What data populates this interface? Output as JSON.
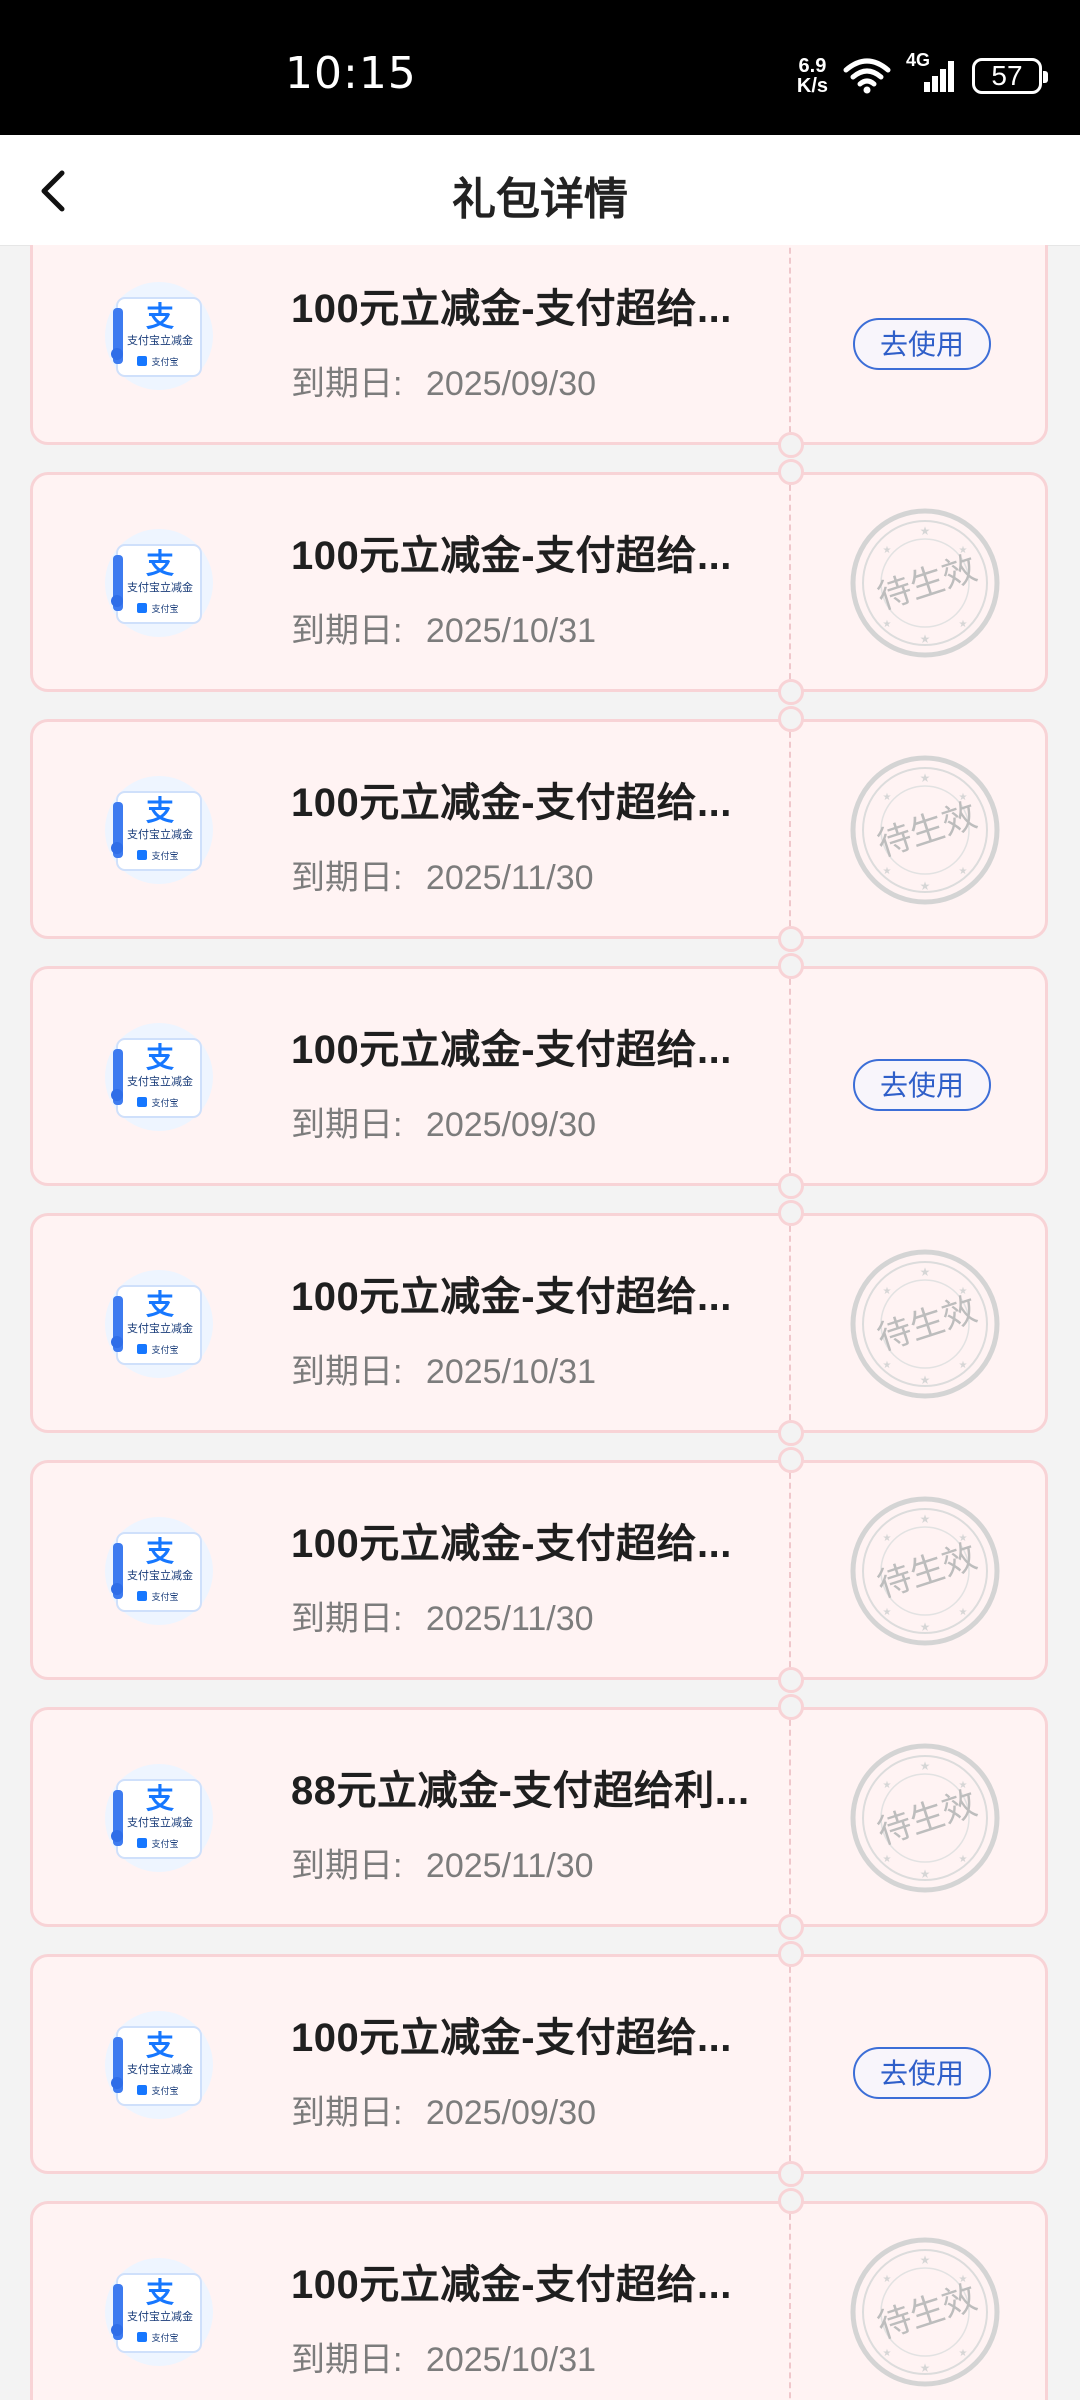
{
  "status_bar": {
    "time": "10:15",
    "speed_value": "6.9",
    "speed_unit": "K/s",
    "network": "4G",
    "battery": "57"
  },
  "nav": {
    "title": "礼包详情"
  },
  "logo_text": {
    "mark": "支",
    "line": "支付宝立减金",
    "brand": "支付宝"
  },
  "expiry_label": "到期日:",
  "stamp_text": "待生效",
  "coupons": [
    {
      "title": "100元立减金-支付超给...",
      "date": "2025/09/30",
      "action": "去使用"
    },
    {
      "title": "100元立减金-支付超给...",
      "date": "2025/10/31",
      "status": "pending"
    },
    {
      "title": "100元立减金-支付超给...",
      "date": "2025/11/30",
      "status": "pending"
    },
    {
      "title": "100元立减金-支付超给...",
      "date": "2025/09/30",
      "action": "去使用"
    },
    {
      "title": "100元立减金-支付超给...",
      "date": "2025/10/31",
      "status": "pending"
    },
    {
      "title": "100元立减金-支付超给...",
      "date": "2025/11/30",
      "status": "pending"
    },
    {
      "title": "88元立减金-支付超给利...",
      "date": "2025/11/30",
      "status": "pending"
    },
    {
      "title": "100元立减金-支付超给...",
      "date": "2025/09/30",
      "action": "去使用"
    },
    {
      "title": "100元立减金-支付超给...",
      "date": "2025/10/31",
      "status": "pending"
    }
  ]
}
